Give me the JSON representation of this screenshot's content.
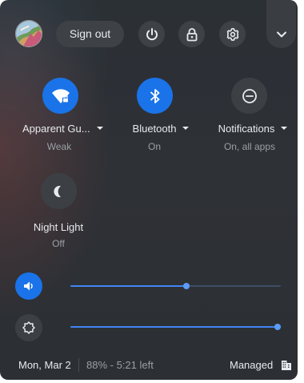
{
  "top": {
    "sign_out_label": "Sign out",
    "icons": [
      "avatar",
      "power-icon",
      "lock-icon",
      "settings-icon",
      "chevron-down-icon"
    ]
  },
  "tiles": [
    {
      "label": "Apparent Gu...",
      "sub": "Weak",
      "icon": "wifi-lock-icon",
      "active": true,
      "has_menu": true
    },
    {
      "label": "Bluetooth",
      "sub": "On",
      "icon": "bluetooth-icon",
      "active": true,
      "has_menu": true
    },
    {
      "label": "Notifications",
      "sub": "On, all apps",
      "icon": "do-not-disturb-icon",
      "active": false,
      "has_menu": true
    },
    {
      "label": "Night Light",
      "sub": "Off",
      "icon": "night-light-icon",
      "active": false,
      "has_menu": false
    }
  ],
  "sliders": {
    "volume": {
      "level": 0.55,
      "icon": "volume-icon",
      "active": true
    },
    "brightness": {
      "level": 1.0,
      "icon": "brightness-icon",
      "active": false
    }
  },
  "footer": {
    "date": "Mon, Mar 2",
    "battery": "88% - 5:21 left",
    "managed": "Managed",
    "managed_icon": "enterprise-building-icon"
  },
  "colors": {
    "accent": "#1a73e8",
    "track_fill": "#4285f4",
    "panel_bg": "#2d3035"
  }
}
